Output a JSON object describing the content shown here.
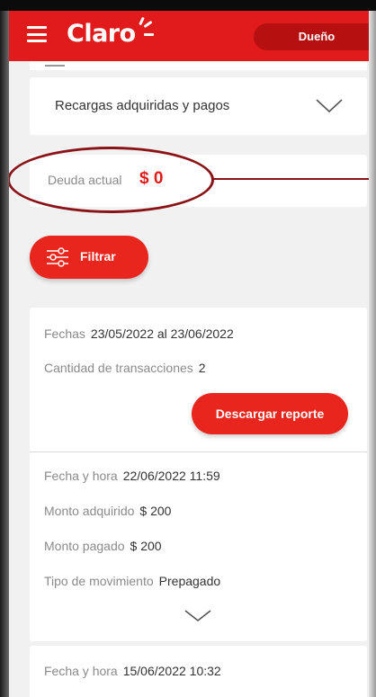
{
  "appbar": {
    "brand": "Claro",
    "role": "Dueño"
  },
  "recargas": {
    "label": "Recargas adquiridas y pagos"
  },
  "deuda": {
    "label": "Deuda actual",
    "amount": "$ 0"
  },
  "filter": {
    "label": "Filtrar"
  },
  "summary": {
    "fechas_label": "Fechas",
    "fechas_value": "23/05/2022 al 23/06/2022",
    "cantidad_label": "Cantidad de transacciones",
    "cantidad_value": "2",
    "download_label": "Descargar reporte"
  },
  "transactions": [
    {
      "fecha_label": "Fecha y hora",
      "fecha_value": "22/06/2022 11:59",
      "adquirido_label": "Monto adquirido",
      "adquirido_value": "$ 200",
      "pagado_label": "Monto pagado",
      "pagado_value": "$ 200",
      "tipo_label": "Tipo de movimiento",
      "tipo_value": "Prepagado"
    },
    {
      "fecha_label": "Fecha y hora",
      "fecha_value": "15/06/2022 10:32"
    }
  ],
  "colors": {
    "brand_red": "#e11b1b",
    "annotation": "#8a1317"
  }
}
